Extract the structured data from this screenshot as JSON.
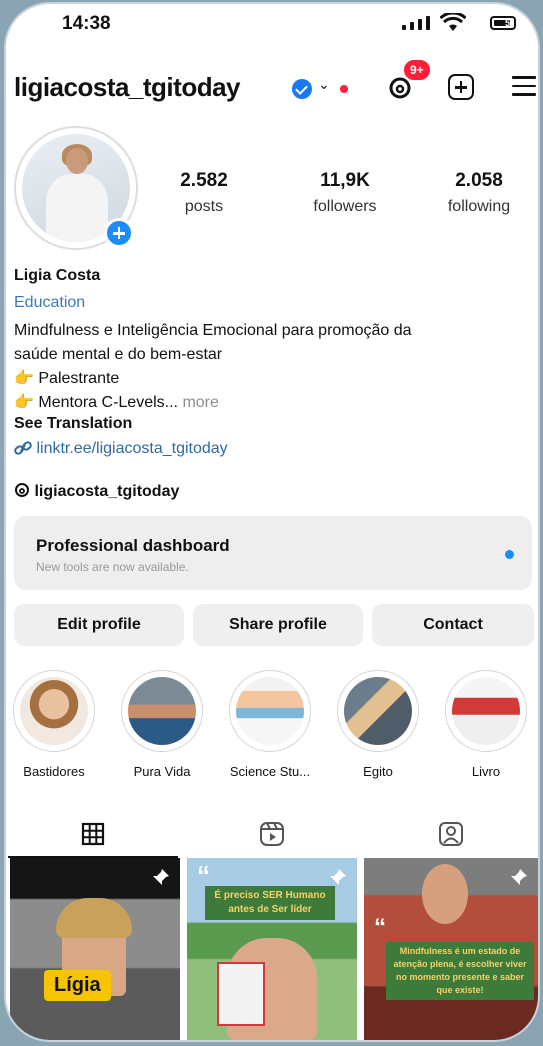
{
  "status": {
    "time": "14:38",
    "battery": "5"
  },
  "header": {
    "username": "ligiacosta_tgitoday",
    "notifications_badge": "9+"
  },
  "stats": [
    {
      "num": "2.582",
      "label": "posts"
    },
    {
      "num": "11,9K",
      "label": "followers"
    },
    {
      "num": "2.058",
      "label": "following"
    }
  ],
  "profile": {
    "name": "Ligia Costa",
    "category": "Education",
    "bio_line1": "Mindfulness e Inteligência Emocional para promoção da",
    "bio_line2": "saúde mental e do bem-estar",
    "bullet1": "Palestrante",
    "bullet2": "Mentora C-Levels...",
    "more": "more",
    "see_translation": "See Translation",
    "link": "linktr.ee/ligiacosta_tgitoday",
    "threads_handle": "ligiacosta_tgitoday"
  },
  "dashboard": {
    "title": "Professional dashboard",
    "subtitle": "New tools are now available."
  },
  "buttons": {
    "edit": "Edit profile",
    "share": "Share profile",
    "contact": "Contact"
  },
  "highlights": [
    {
      "label": "Bastidores"
    },
    {
      "label": "Pura Vida"
    },
    {
      "label": "Science Stu..."
    },
    {
      "label": "Egito"
    },
    {
      "label": "Livro"
    }
  ],
  "posts": {
    "tile1_text": "Lígia",
    "tile2_text": "É preciso SER Humano antes de Ser líder",
    "tile3_text": "Mindfulness é um estado de atenção plena, é escolher viver no momento presente e saber que existe!"
  },
  "colors": {
    "accent_blue": "#1a8cff",
    "badge_red": "#ff1d3a",
    "link_blue": "#2f6aa3"
  }
}
